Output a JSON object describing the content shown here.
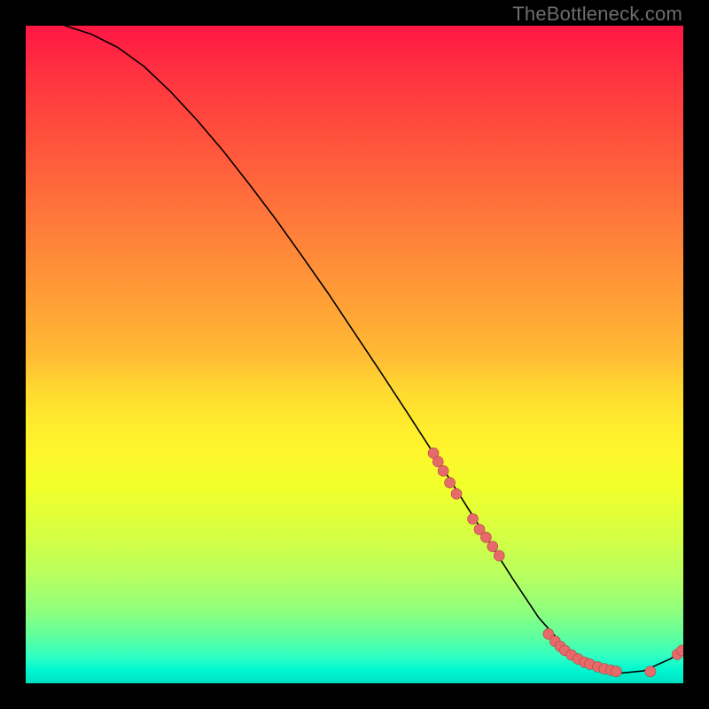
{
  "watermark": "TheBottleneck.com",
  "chart_data": {
    "type": "line",
    "title": "",
    "xlabel": "",
    "ylabel": "",
    "xlim": [
      0,
      100
    ],
    "ylim": [
      0,
      100
    ],
    "grid": false,
    "legend": false,
    "background_gradient": {
      "top": "#ff1744",
      "middle": "#ffea2e",
      "bottom": "#00e0c0"
    },
    "series": [
      {
        "name": "curve",
        "type": "line",
        "x": [
          6,
          10,
          14,
          18,
          22,
          26,
          30,
          34,
          38,
          42,
          46,
          50,
          54,
          58,
          62,
          66,
          70,
          74,
          78,
          82,
          86,
          90,
          94,
          98,
          100
        ],
        "values": [
          100,
          98.7,
          96.7,
          93.8,
          90.0,
          85.7,
          81.0,
          75.9,
          70.6,
          65.0,
          59.3,
          53.3,
          47.3,
          41.2,
          35.0,
          28.6,
          22.3,
          16.0,
          10.0,
          5.5,
          2.7,
          1.5,
          1.9,
          3.7,
          5.0
        ]
      },
      {
        "name": "markers",
        "type": "scatter",
        "x": [
          62.0,
          62.7,
          63.5,
          64.5,
          65.5,
          68.0,
          69.0,
          70.0,
          71.0,
          72.0,
          79.5,
          80.5,
          81.3,
          82.0,
          83.0,
          84.0,
          85.0,
          85.8,
          87.0,
          88.0,
          89.0,
          89.8,
          95.0,
          99.1,
          99.8
        ],
        "values": [
          35.0,
          33.7,
          32.3,
          30.5,
          28.8,
          25.0,
          23.4,
          22.2,
          20.8,
          19.4,
          7.5,
          6.4,
          5.6,
          5.0,
          4.3,
          3.7,
          3.2,
          2.9,
          2.5,
          2.2,
          2.0,
          1.8,
          1.8,
          4.4,
          5.0
        ]
      }
    ]
  }
}
